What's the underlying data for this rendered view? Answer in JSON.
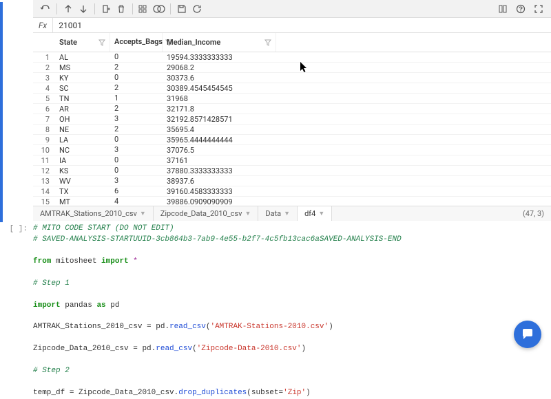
{
  "formula": {
    "label": "Fx",
    "value": "21001"
  },
  "columns": {
    "state": "State",
    "bags": "Accepts_Bags",
    "income": "Median_Income"
  },
  "rows": [
    {
      "n": 1,
      "state": "AL",
      "bags": 0,
      "income": "19594.3333333333"
    },
    {
      "n": 2,
      "state": "MS",
      "bags": 2,
      "income": "29068.2"
    },
    {
      "n": 3,
      "state": "KY",
      "bags": 0,
      "income": "30373.6"
    },
    {
      "n": 4,
      "state": "SC",
      "bags": 2,
      "income": "30389.4545454545"
    },
    {
      "n": 5,
      "state": "TN",
      "bags": 1,
      "income": "31968"
    },
    {
      "n": 6,
      "state": "AR",
      "bags": 2,
      "income": "32171.8"
    },
    {
      "n": 7,
      "state": "OH",
      "bags": 3,
      "income": "32192.8571428571"
    },
    {
      "n": 8,
      "state": "NE",
      "bags": 2,
      "income": "35695.4"
    },
    {
      "n": 9,
      "state": "LA",
      "bags": 0,
      "income": "35965.4444444444"
    },
    {
      "n": 10,
      "state": "NC",
      "bags": 3,
      "income": "37076.5"
    },
    {
      "n": 11,
      "state": "IA",
      "bags": 0,
      "income": "37161"
    },
    {
      "n": 12,
      "state": "KS",
      "bags": 0,
      "income": "37880.3333333333"
    },
    {
      "n": 13,
      "state": "WV",
      "bags": 3,
      "income": "38937.6"
    },
    {
      "n": 14,
      "state": "TX",
      "bags": 6,
      "income": "39160.4583333333"
    },
    {
      "n": 15,
      "state": "MT",
      "bags": 4,
      "income": "39886.0909090909"
    }
  ],
  "tabs": {
    "t1": "AMTRAK_Stations_2010_csv",
    "t2": "Zipcode_Data_2010_csv",
    "t3": "Data",
    "t4": "df4",
    "shape": "(47, 3)"
  },
  "code": {
    "prompt": "[ ]:",
    "c1": "# MITO CODE START (DO NOT EDIT)",
    "c2": "# SAVED-ANALYSIS-STARTUUID-3cb864b3-7ab9-4e55-b2f7-4c5fb13cac6aSAVED-ANALYSIS-END",
    "l_from": "from",
    "l_mito": "mitosheet",
    "l_import": "import",
    "l_star": "*",
    "step1": "# Step 1",
    "l_pandas": "pandas",
    "l_as": "as",
    "l_pd": "pd",
    "v1": "AMTRAK_Stations_2010_csv",
    "eq": " = ",
    "pd": "pd",
    "dot": ".",
    "read_csv": "read_csv",
    "f1": "'AMTRAK-Stations-2010.csv'",
    "v2": "Zipcode_Data_2010_csv",
    "f2": "'Zipcode-Data-2010.csv'",
    "step2": "# Step 2",
    "v3": "temp_df",
    "drop": "drop_duplicates",
    "subset": "subset",
    "zip": "'Zip'"
  }
}
